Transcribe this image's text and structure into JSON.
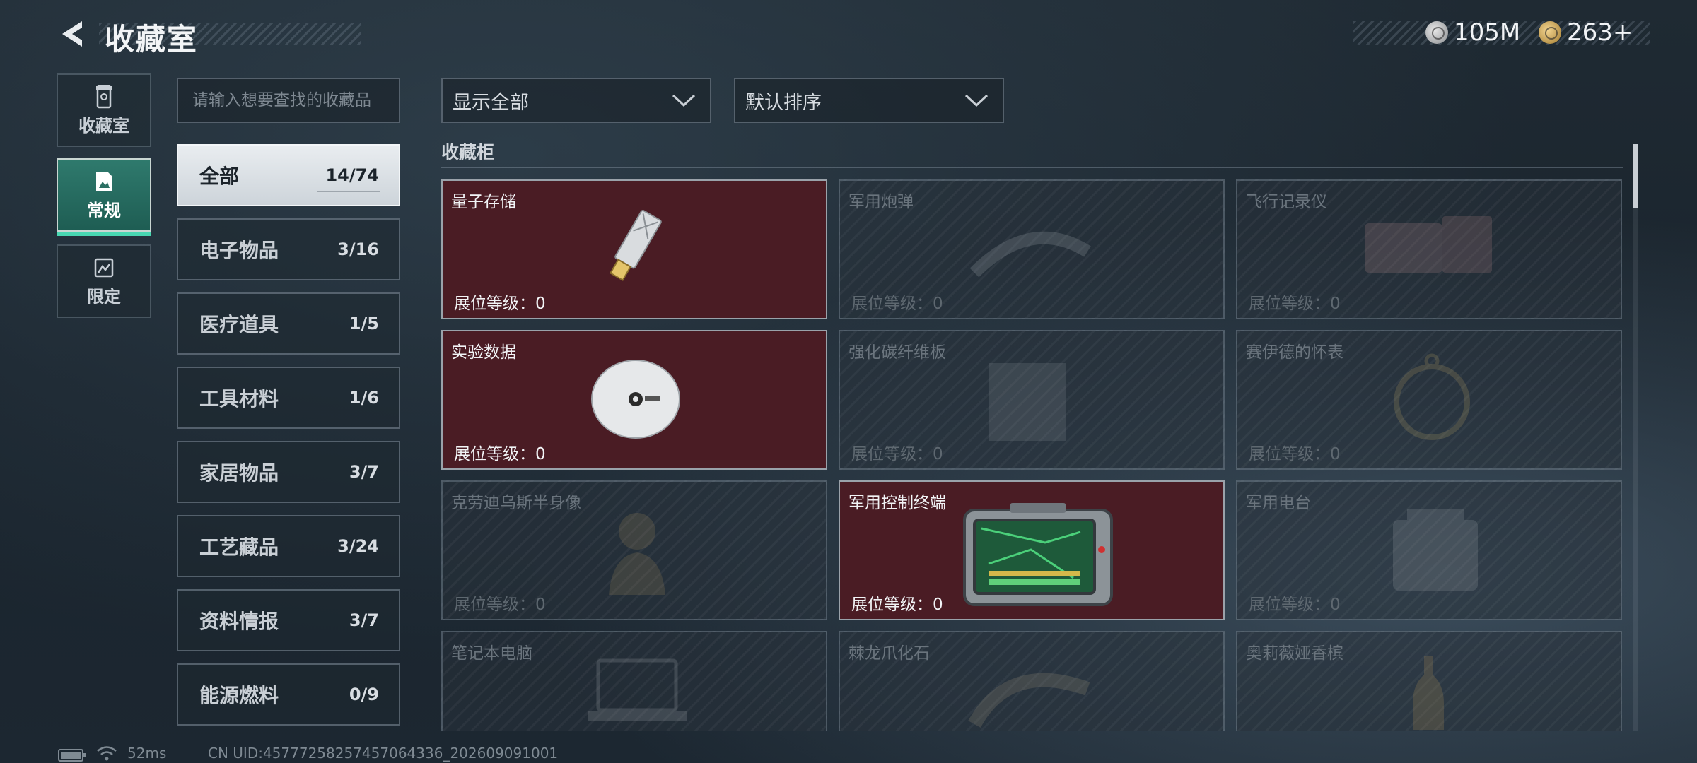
{
  "header": {
    "title": "收藏室",
    "currency": [
      {
        "icon": "silver-coin-icon",
        "value": "105M"
      },
      {
        "icon": "gold-coin-icon",
        "value": "263+"
      }
    ]
  },
  "side_nav": [
    {
      "label": "收藏室",
      "icon": "collection-room-icon",
      "active": false
    },
    {
      "label": "常规",
      "icon": "regular-icon",
      "active": true
    },
    {
      "label": "限定",
      "icon": "limited-icon",
      "active": false
    }
  ],
  "search": {
    "placeholder": "请输入想要查找的收藏品"
  },
  "categories": [
    {
      "name": "全部",
      "count": "14/74",
      "active": true
    },
    {
      "name": "电子物品",
      "count": "3/16"
    },
    {
      "name": "医疗道具",
      "count": "1/5"
    },
    {
      "name": "工具材料",
      "count": "1/6"
    },
    {
      "name": "家居物品",
      "count": "3/7"
    },
    {
      "name": "工艺藏品",
      "count": "3/24"
    },
    {
      "name": "资料情报",
      "count": "3/7"
    },
    {
      "name": "能源燃料",
      "count": "0/9"
    }
  ],
  "filters": {
    "filter_value": "显示全部",
    "sort_value": "默认排序"
  },
  "cabinet": {
    "title": "收藏柜",
    "level_label": "展位等级：0",
    "items": [
      {
        "name": "量子存储",
        "owned": true,
        "icon": "usb-drive-icon"
      },
      {
        "name": "军用炮弹",
        "owned": false,
        "icon": "artillery-shell-icon"
      },
      {
        "name": "飞行记录仪",
        "owned": false,
        "icon": "flight-recorder-icon"
      },
      {
        "name": "实验数据",
        "owned": true,
        "icon": "disc-icon"
      },
      {
        "name": "强化碳纤维板",
        "owned": false,
        "icon": "carbon-fiber-plate-icon"
      },
      {
        "name": "赛伊德的怀表",
        "owned": false,
        "icon": "pocket-watch-icon"
      },
      {
        "name": "克劳迪乌斯半身像",
        "owned": false,
        "icon": "bust-statue-icon"
      },
      {
        "name": "军用控制终端",
        "owned": true,
        "icon": "control-terminal-icon"
      },
      {
        "name": "军用电台",
        "owned": false,
        "icon": "military-radio-icon"
      },
      {
        "name": "笔记本电脑",
        "owned": false,
        "icon": "laptop-icon"
      },
      {
        "name": "棘龙爪化石",
        "owned": false,
        "icon": "claw-fossil-icon"
      },
      {
        "name": "奥莉薇娅香槟",
        "owned": false,
        "icon": "champagne-bottle-icon"
      }
    ]
  },
  "status_bar": {
    "ping": "52ms",
    "uid": "CN UID:457772582574570643​36_202609091001"
  },
  "colors": {
    "accent_green": "#48d7b2",
    "owned_card": "#4a1c24",
    "background": "#1f2a33"
  }
}
